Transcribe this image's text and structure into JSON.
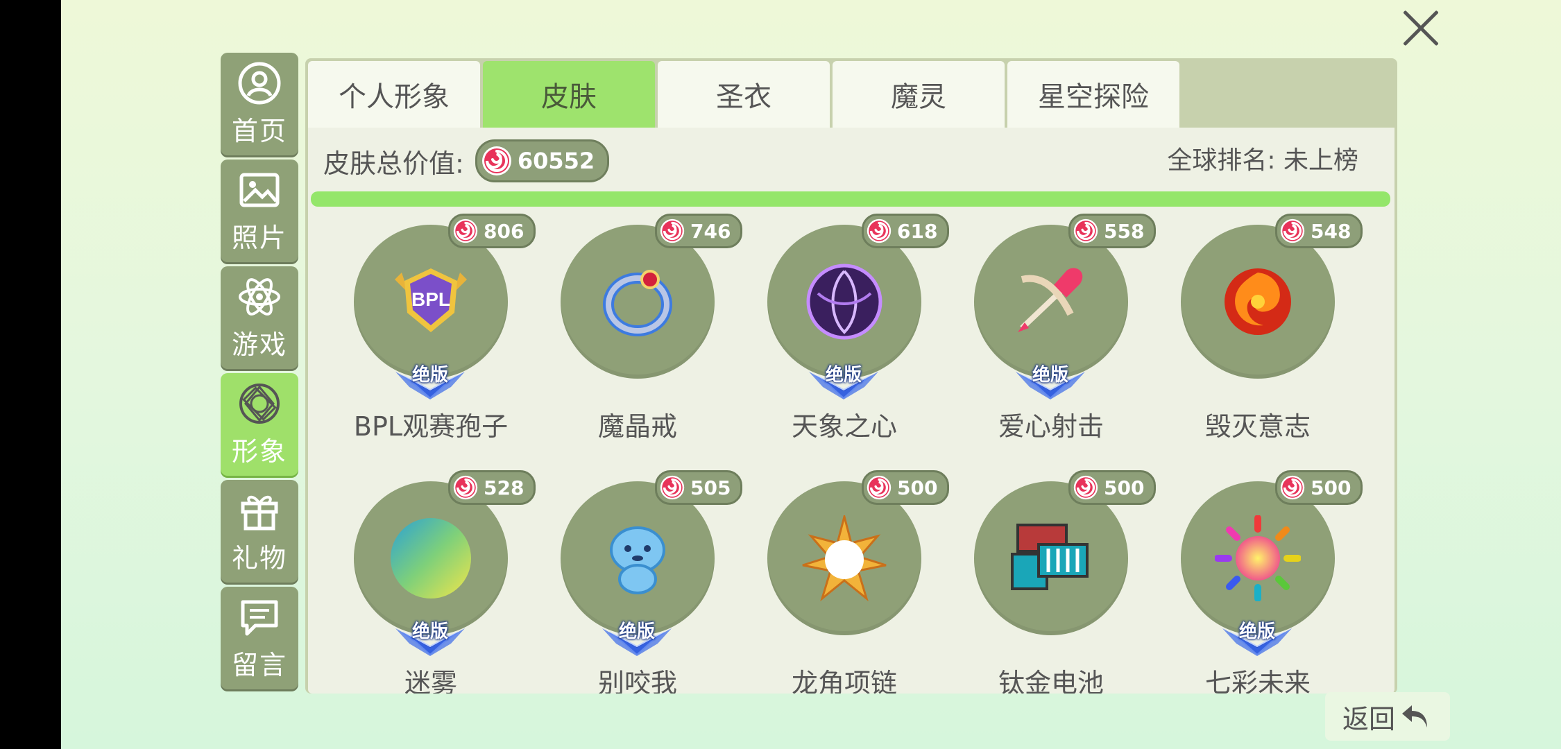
{
  "sidebar": {
    "items": [
      {
        "label": "首页",
        "icon": "user-circle-icon",
        "active": false
      },
      {
        "label": "照片",
        "icon": "photo-icon",
        "active": false
      },
      {
        "label": "游戏",
        "icon": "atom-icon",
        "active": false
      },
      {
        "label": "形象",
        "icon": "gem-icon",
        "active": true
      },
      {
        "label": "礼物",
        "icon": "gift-icon",
        "active": false
      },
      {
        "label": "留言",
        "icon": "message-icon",
        "active": false
      }
    ]
  },
  "tabs": [
    "个人形象",
    "皮肤",
    "圣衣",
    "魔灵",
    "星空探险"
  ],
  "active_tab": "皮肤",
  "summary": {
    "label": "皮肤总价值:",
    "total": "60552",
    "rank": "全球排名: 未上榜",
    "progress_fraction": 1.0
  },
  "badge_text": "绝版",
  "items": [
    {
      "name": "BPL观赛孢子",
      "price": "806",
      "icon": "bpl-badge-icon",
      "limited": true
    },
    {
      "name": "魔晶戒",
      "price": "746",
      "icon": "ring-icon",
      "limited": false
    },
    {
      "name": "天象之心",
      "price": "618",
      "icon": "purple-orb-icon",
      "limited": true
    },
    {
      "name": "爱心射击",
      "price": "558",
      "icon": "heart-arrow-icon",
      "limited": true
    },
    {
      "name": "毁灭意志",
      "price": "548",
      "icon": "fire-swirl-icon",
      "limited": false
    },
    {
      "name": "迷雾",
      "price": "528",
      "icon": "gradient-orb-icon",
      "limited": true
    },
    {
      "name": "别咬我",
      "price": "505",
      "icon": "blue-creature-icon",
      "limited": true
    },
    {
      "name": "龙角项链",
      "price": "500",
      "icon": "sun-burst-icon",
      "limited": false
    },
    {
      "name": "钛金电池",
      "price": "500",
      "icon": "battery-icon",
      "limited": false
    },
    {
      "name": "七彩未来",
      "price": "500",
      "icon": "rainbow-sun-icon",
      "limited": true
    }
  ],
  "back_label": "返回",
  "colors": {
    "active_green": "#9ee36d",
    "muted_green": "#8fa077",
    "candy_red": "#e8335a"
  }
}
